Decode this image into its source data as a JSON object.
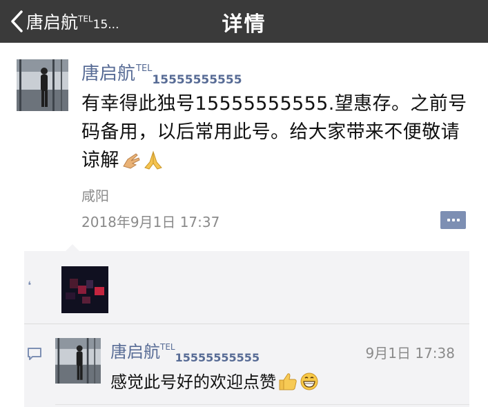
{
  "navbar": {
    "back_label": "唐启航",
    "back_tel": "TEL",
    "back_number": "15...",
    "title": "详情"
  },
  "post": {
    "author_name": "唐启航",
    "author_tel": "TEL",
    "author_number": "15555555555",
    "text": "有幸得此独号15555555555.望惠存。之前号码备用，以后常用此号。给大家带来不便敬请谅解",
    "emojis": [
      "raised-hand-emoji",
      "folded-hands-emoji"
    ],
    "location": "咸阳",
    "time": "2018年9月1日 17:37",
    "action_icon": "comment-bubble-icon"
  },
  "interactions": {
    "likes_icon": "like-icon",
    "comment": {
      "icon": "comment-icon",
      "author_name": "唐启航",
      "author_tel": "TEL",
      "author_number": "15555555555",
      "time": "9月1日 17:38",
      "text": "感觉此号好的欢迎点赞",
      "emojis": [
        "thumbs-up-emoji",
        "grinning-emoji"
      ]
    }
  },
  "colors": {
    "navbar": "#3a3a3a",
    "link": "#576b95",
    "panel": "#f3f3f5",
    "meta_text": "#8a8a8a"
  }
}
